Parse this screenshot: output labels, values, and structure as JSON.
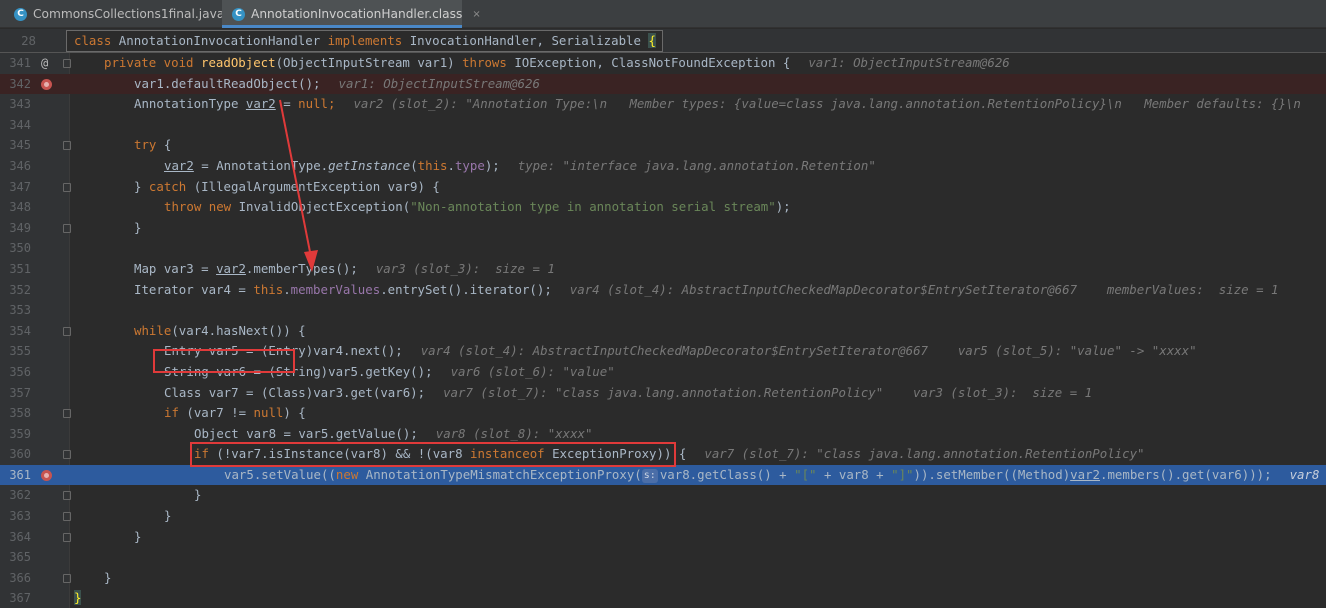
{
  "tabs": [
    {
      "icon": "C",
      "label": "CommonsCollections1final.java",
      "active": false
    },
    {
      "icon": "C",
      "label": "AnnotationInvocationHandler.class",
      "active": true
    }
  ],
  "close_glyph": "×",
  "sticky": {
    "line_number": "28",
    "kw_class": "class",
    "class_name": " AnnotationInvocationHandler ",
    "kw_implements": "implements",
    "interfaces": " InvocationHandler, Serializable ",
    "brace": "{"
  },
  "code": {
    "l341": {
      "n": "341",
      "kw": "private void ",
      "fn": "readObject",
      "p1": "(ObjectInputStream var1) ",
      "kw2": "throws",
      "p2": " IOException, ClassNotFoundException {",
      "hint": "var1: ObjectInputStream@626"
    },
    "l342": {
      "n": "342",
      "t": "var1.defaultReadObject();",
      "hint": "var1: ObjectInputStream@626"
    },
    "l343": {
      "n": "343",
      "a": "AnnotationType ",
      "v": "var2",
      "b": " = ",
      "kw": "null",
      "c": ";",
      "hint": "var2 (slot_2): \"Annotation Type:\\n   Member types: {value=class java.lang.annotation.RetentionPolicy}\\n   Member defaults: {}\\n"
    },
    "l344": {
      "n": "344"
    },
    "l345": {
      "n": "345",
      "kw": "try",
      "t": " {"
    },
    "l346": {
      "n": "346",
      "v": "var2",
      "a": " = AnnotationType.",
      "st": "getInstance",
      "b": "(",
      "kw": "this",
      "c": ".",
      "fld": "type",
      "d": ");",
      "hint": "type: \"interface java.lang.annotation.Retention\""
    },
    "l347": {
      "n": "347",
      "a": "} ",
      "kw": "catch",
      "b": " (IllegalArgumentException var9) {"
    },
    "l348": {
      "n": "348",
      "kw1": "throw new",
      "a": " InvalidObjectException(",
      "str": "\"Non-annotation type in annotation serial stream\"",
      "b": ");"
    },
    "l349": {
      "n": "349",
      "t": "}"
    },
    "l350": {
      "n": "350"
    },
    "l351": {
      "n": "351",
      "a": "Map var3 = ",
      "v": "var2",
      "b": ".memberTypes();",
      "hint": "var3 (slot_3):  size = 1"
    },
    "l352": {
      "n": "352",
      "a": "Iterator var4 = ",
      "kw": "this",
      "b": ".",
      "fld": "memberValues",
      "c": ".entrySet().iterator();",
      "hint": "var4 (slot_4): AbstractInputCheckedMapDecorator$EntrySetIterator@667    memberValues:  size = 1"
    },
    "l353": {
      "n": "353"
    },
    "l354": {
      "n": "354",
      "kw": "while",
      "t": "(var4.hasNext()) {"
    },
    "l355": {
      "n": "355",
      "t": "Entry var5 = (Entry)var4.next();",
      "hint": "var4 (slot_4): AbstractInputCheckedMapDecorator$EntrySetIterator@667    var5 (slot_5): \"value\" -> \"xxxx\""
    },
    "l356": {
      "n": "356",
      "t": "String var6 = (String)var5.getKey();",
      "hint": "var6 (slot_6): \"value\""
    },
    "l357": {
      "n": "357",
      "t": "Class var7 = (Class)var3.get(var6);",
      "hint": "var7 (slot_7): \"class java.lang.annotation.RetentionPolicy\"    var3 (slot_3):  size = 1"
    },
    "l358": {
      "n": "358",
      "kw": "if",
      "a": " (var7 != ",
      "kw2": "null",
      "b": ") {"
    },
    "l359": {
      "n": "359",
      "t": "Object var8 = var5.getValue();",
      "hint": "var8 (slot_8): \"xxxx\""
    },
    "l360": {
      "n": "360",
      "kw": "if",
      "a": " (!var7.isInstance(var8) && !(var8 ",
      "kw2": "instanceof",
      "b": " ExceptionProxy)) {",
      "hint": "var7 (slot_7): \"class java.lang.annotation.RetentionPolicy\""
    },
    "l361": {
      "n": "361",
      "a": "var5.setValue((",
      "kw": "new",
      "b": " AnnotationTypeMismatchExceptionProxy(",
      "badge": "s:",
      "c": "var8.getClass() + ",
      "s1": "\"[\"",
      "d": " + var8 + ",
      "s2": "\"]\"",
      "e": ")).setMember((Method)",
      "v": "var2",
      "f": ".members().get(var6)));",
      "hint": "var8"
    },
    "l362": {
      "n": "362",
      "t": "}"
    },
    "l363": {
      "n": "363",
      "t": "}"
    },
    "l364": {
      "n": "364",
      "t": "}"
    },
    "l365": {
      "n": "365"
    },
    "l366": {
      "n": "366",
      "t": "}"
    },
    "l367": {
      "n": "367",
      "t": "}"
    }
  },
  "colors": {
    "editor_bg": "#2b2b2b",
    "keyword": "#cc7832",
    "method": "#ffc66d",
    "string": "#6a8759",
    "field": "#9876aa",
    "exec_line": "#2d5b9e",
    "breakpoint": "#c75450",
    "annotation_red": "#e03a3a"
  }
}
